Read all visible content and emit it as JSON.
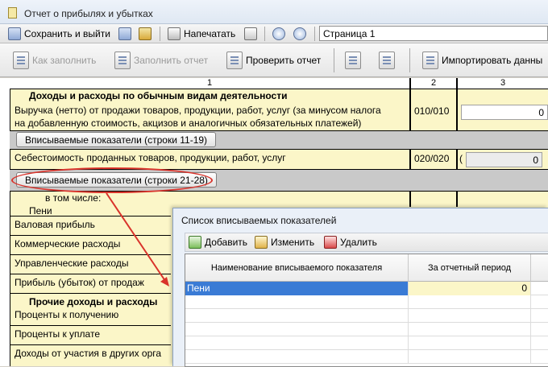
{
  "window": {
    "title": "Отчет о прибылях и убытках"
  },
  "toolbar1": {
    "save_exit": "Сохранить и выйти",
    "print": "Напечатать",
    "page_value": "Страница 1"
  },
  "toolbar2": {
    "how_to_fill": "Как заполнить",
    "fill_report": "Заполнить отчет",
    "check_report": "Проверить отчет",
    "import_data": "Импортировать данны"
  },
  "sheet": {
    "col_headers": [
      "1",
      "2",
      "3"
    ],
    "section1": "Доходы и расходы по обычным видам деятельности",
    "revenue_line1": "Выручка (нетто) от продажи товаров, продукции, работ, услуг (за минусом налога",
    "revenue_line2": "на добавленную стоимость, акцизов и аналогичных обязательных платежей)",
    "revenue_code": "010/010",
    "revenue_value": "0",
    "btn_rows_11_19": "Вписываемые показатели (строки 11-19)",
    "cost_label": "Себестоимость проданных товаров, продукции, работ, услуг",
    "cost_code": "020/020",
    "cost_paren": "(",
    "cost_value": "0",
    "btn_rows_21_28": "Вписываемые показатели (строки 21-28)",
    "including": "в том числе:",
    "peni": "Пени",
    "gross_profit": "Валовая прибыль",
    "commercial": "Коммерческие расходы",
    "management": "Управленческие расходы",
    "profit_sales": "Прибыль (убыток) от продаж",
    "section2": "Прочие доходы и расходы",
    "interest_receive": "Проценты к получению",
    "interest_pay": "Проценты к уплате",
    "participation": "Доходы от участия в других орга"
  },
  "dialog": {
    "title": "Список вписываемых показателей",
    "add": "Добавить",
    "edit": "Изменить",
    "delete": "Удалить",
    "col_name": "Наименование вписываемого показателя",
    "col_period": "За отчетный период",
    "rows": [
      {
        "name": "Пени",
        "value": "0"
      }
    ]
  },
  "colors": {
    "highlight": "#d9332b",
    "selected_row": "#3a7bd5",
    "input_yellow": "#fbf6c8"
  }
}
